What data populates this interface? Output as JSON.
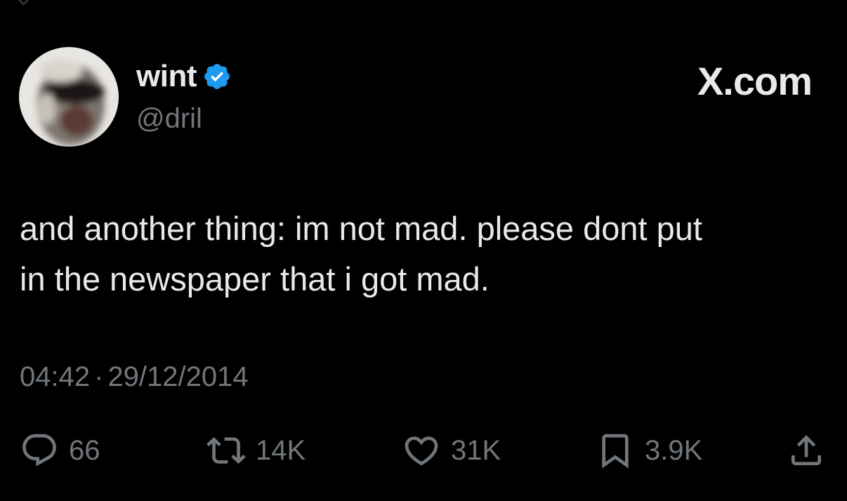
{
  "user": {
    "display_name": "wint",
    "handle": "@dril",
    "verified": true
  },
  "brand": {
    "label": "X.com"
  },
  "tweet": {
    "text": "and another thing: im not mad. please dont put\nin the newspaper that i got mad.",
    "time": "04:42",
    "separator": "·",
    "date": "29/12/2014"
  },
  "actions": {
    "replies": "66",
    "retweets": "14K",
    "likes": "31K",
    "bookmarks": "3.9K"
  },
  "colors": {
    "background": "#000000",
    "text": "#e7e9ea",
    "muted": "#71767b",
    "verified": "#1d9bf0"
  },
  "icons": {
    "reply": "speech-bubble-icon",
    "retweet": "retweet-arrows-icon",
    "like": "heart-outline-icon",
    "bookmark": "bookmark-icon",
    "share": "share-upload-icon",
    "verified": "verified-badge-icon"
  }
}
